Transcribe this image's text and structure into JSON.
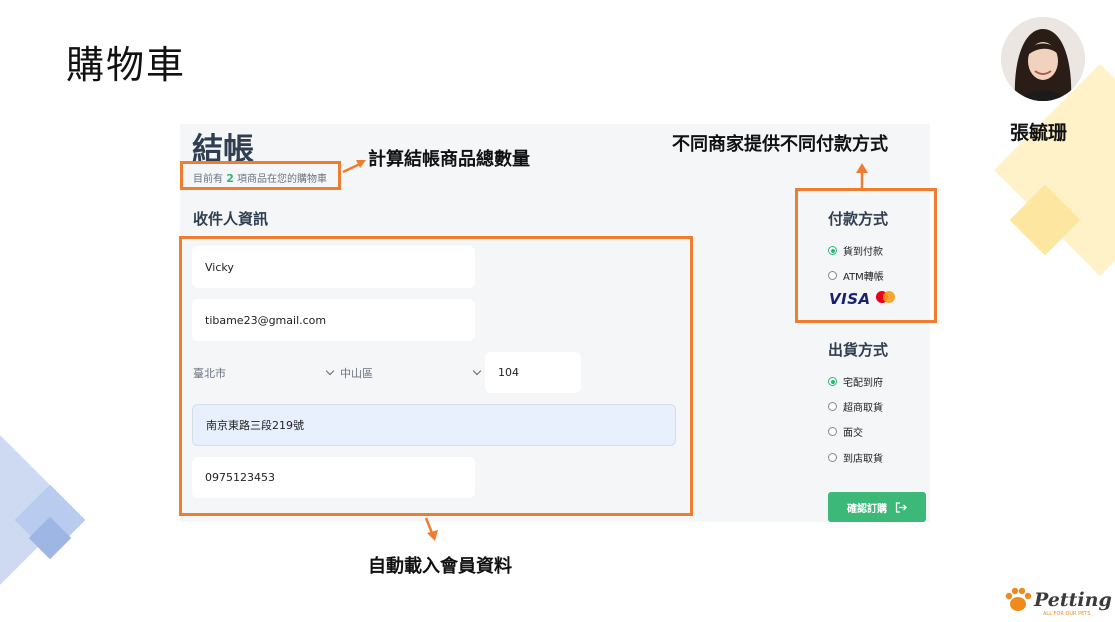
{
  "slide": {
    "title": "購物車",
    "presenter_name": "張毓珊"
  },
  "checkout": {
    "title": "結帳",
    "cart_prefix": "目前有",
    "cart_count": "2",
    "cart_suffix": "項商品在您的購物車",
    "recipient_heading": "收件人資訊",
    "name_value": "Vicky",
    "email_value": "tibame23@gmail.com",
    "city_value": "臺北市",
    "district_value": "中山區",
    "zip_value": "104",
    "address_value": "南京東路三段219號",
    "phone_value": "0975123453",
    "payment_heading": "付款方式",
    "payment_options": [
      "貨到付款",
      "ATM轉帳"
    ],
    "payment_brands": [
      "VISA",
      "mastercard"
    ],
    "shipping_heading": "出貨方式",
    "shipping_options": [
      "宅配到府",
      "超商取貨",
      "面交",
      "到店取貨"
    ],
    "confirm_label": "確認訂購"
  },
  "annotations": {
    "count_note": "計算結帳商品總數量",
    "payment_note": "不同商家提供不同付款方式",
    "autofill_note": "自動載入會員資料"
  },
  "colors": {
    "annotation_orange": "#ee7d31",
    "accent_green": "#3cb878",
    "deco_blue": "#a9c0e8",
    "deco_yellow": "#fde9a3"
  },
  "icons": {
    "confirm": "sign-out-icon",
    "logo": "paw-icon"
  },
  "logo": {
    "text": "Petting",
    "tagline": "ALL FOR OUR PETS"
  }
}
